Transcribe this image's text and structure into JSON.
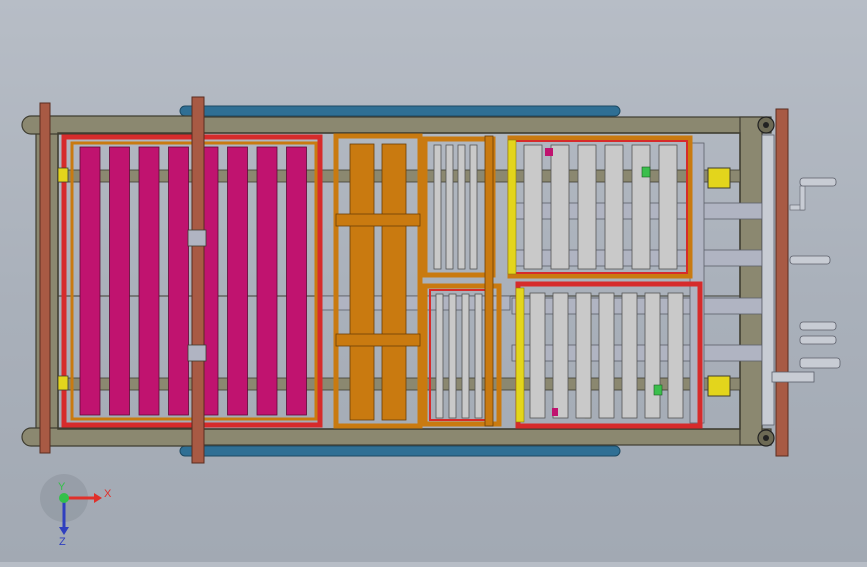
{
  "view": {
    "background_top": "#b7bdc6",
    "background_bottom": "#a2a9b3"
  },
  "colors": {
    "frame": "#8b8870",
    "frame_dark": "#3f3d31",
    "rust": "#a85a44",
    "blue_rod": "#2f6f94",
    "magenta": "#c0136f",
    "orange": "#c97a10",
    "red": "#d62b2b",
    "yellow": "#e3d51c",
    "grey_slat": "#c9c9c9",
    "pipe": "#b0b4c2",
    "green": "#3bbf4c"
  },
  "triad": {
    "x_label": "X",
    "y_label": "Y",
    "z_label": "Z",
    "x_color": "#e0302a",
    "y_color": "#34c04a",
    "z_color": "#2f3fbf"
  }
}
